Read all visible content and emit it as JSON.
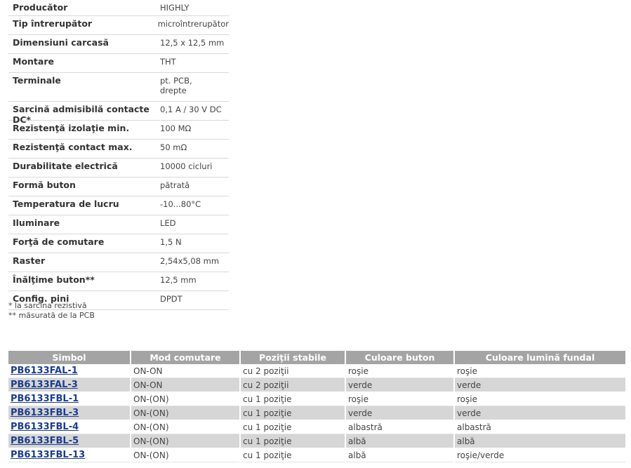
{
  "specs": [
    {
      "label": "Producător",
      "value": "HIGHLY"
    },
    {
      "label": "Tip întrerupător",
      "value": "microîntrerupător"
    },
    {
      "label": "Dimensiuni carcasă",
      "value": "12,5 x 12,5 mm"
    },
    {
      "label": "Montare",
      "value": "THT"
    },
    {
      "label": "Terminale",
      "value": "pt. PCB,\ndrepte"
    },
    {
      "label": "Sarcină admisibilă contacte DC*",
      "value": "0,1 A / 30 V DC"
    },
    {
      "label": "Rezistenţă izolaţie min.",
      "value": "100 MΩ"
    },
    {
      "label": "Rezistenţă contact max.",
      "value": "50 mΩ"
    },
    {
      "label": "Durabilitate electrică",
      "value": "10000 cicluri"
    },
    {
      "label": "Formă buton",
      "value": "pătrată"
    },
    {
      "label": "Temperatura de lucru",
      "value": "-10...80°C"
    },
    {
      "label": "Iluminare",
      "value": "LED"
    },
    {
      "label": "Forţă de comutare",
      "value": "1,5 N"
    },
    {
      "label": "Raster",
      "value": "2,54x5,08 mm"
    },
    {
      "label": "Înălţime buton**",
      "value": "12,5 mm"
    },
    {
      "label": "Config. pini",
      "value": "DPDT"
    }
  ],
  "footnotes": [
    "* la sarcina rezistivă",
    "** măsurată de la PCB"
  ],
  "products": {
    "headers": [
      "Simbol",
      "Mod comutare",
      "Poziţii stabile",
      "Culoare buton",
      "Culoare lumină fundal"
    ],
    "rows": [
      [
        "PB6133FAL-1",
        "ON-ON",
        "cu 2 poziţii",
        "roşie",
        "roşie"
      ],
      [
        "PB6133FAL-3",
        "ON-ON",
        "cu 2 poziţii",
        "verde",
        "verde"
      ],
      [
        "PB6133FBL-1",
        "ON-(ON)",
        "cu 1 poziţie",
        "roşie",
        "roşie"
      ],
      [
        "PB6133FBL-3",
        "ON-(ON)",
        "cu 1 poziţie",
        "verde",
        "verde"
      ],
      [
        "PB6133FBL-4",
        "ON-(ON)",
        "cu 1 poziţie",
        "albastră",
        "albastră"
      ],
      [
        "PB6133FBL-5",
        "ON-(ON)",
        "cu 1 poziţie",
        "albă",
        "albă"
      ],
      [
        "PB6133FBL-13",
        "ON-(ON)",
        "cu 1 poziţie",
        "albă",
        "roşie/verde"
      ]
    ]
  },
  "colors": {
    "header_bg": "#a4a4a4",
    "link": "#1c3d8c",
    "alt_row": "#d6d6d6"
  }
}
